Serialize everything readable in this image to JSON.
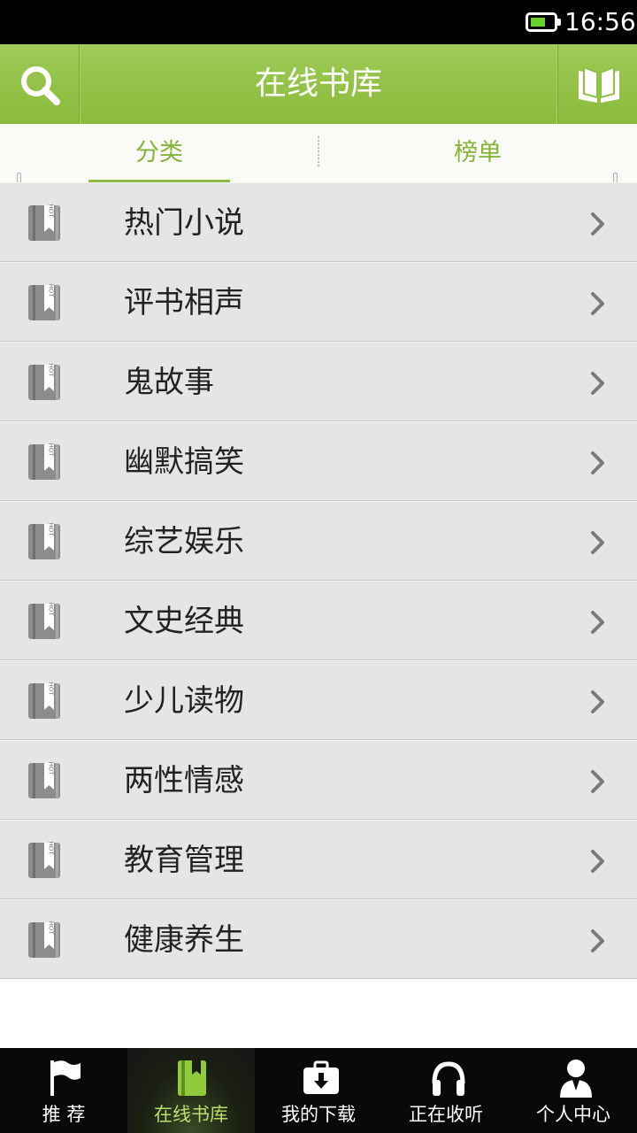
{
  "status_bar": {
    "time": "16:56"
  },
  "header": {
    "title": "在线书库"
  },
  "tabs": [
    {
      "label": "分类",
      "active": true
    },
    {
      "label": "榜单",
      "active": false
    }
  ],
  "categories": [
    {
      "label": "热门小说",
      "icon": "hot-book-icon"
    },
    {
      "label": "评书相声",
      "icon": "hot-book-icon"
    },
    {
      "label": "鬼故事",
      "icon": "hot-book-icon"
    },
    {
      "label": "幽默搞笑",
      "icon": "hot-book-icon"
    },
    {
      "label": "综艺娱乐",
      "icon": "hot-book-icon"
    },
    {
      "label": "文史经典",
      "icon": "hot-book-icon"
    },
    {
      "label": "少儿读物",
      "icon": "hot-book-icon"
    },
    {
      "label": "两性情感",
      "icon": "hot-book-icon"
    },
    {
      "label": "教育管理",
      "icon": "hot-book-icon"
    },
    {
      "label": "健康养生",
      "icon": "hot-book-icon"
    }
  ],
  "bottom_nav": [
    {
      "label": "推 荐",
      "icon": "flag-icon",
      "active": false
    },
    {
      "label": "在线书库",
      "icon": "book-icon",
      "active": true
    },
    {
      "label": "我的下载",
      "icon": "download-box-icon",
      "active": false
    },
    {
      "label": "正在收听",
      "icon": "headphones-icon",
      "active": false
    },
    {
      "label": "个人中心",
      "icon": "person-icon",
      "active": false
    }
  ],
  "colors": {
    "header_green": "#8fbf45",
    "accent_green": "#86b43a",
    "list_bg": "#e5e5e5",
    "nav_bg": "#090909"
  }
}
